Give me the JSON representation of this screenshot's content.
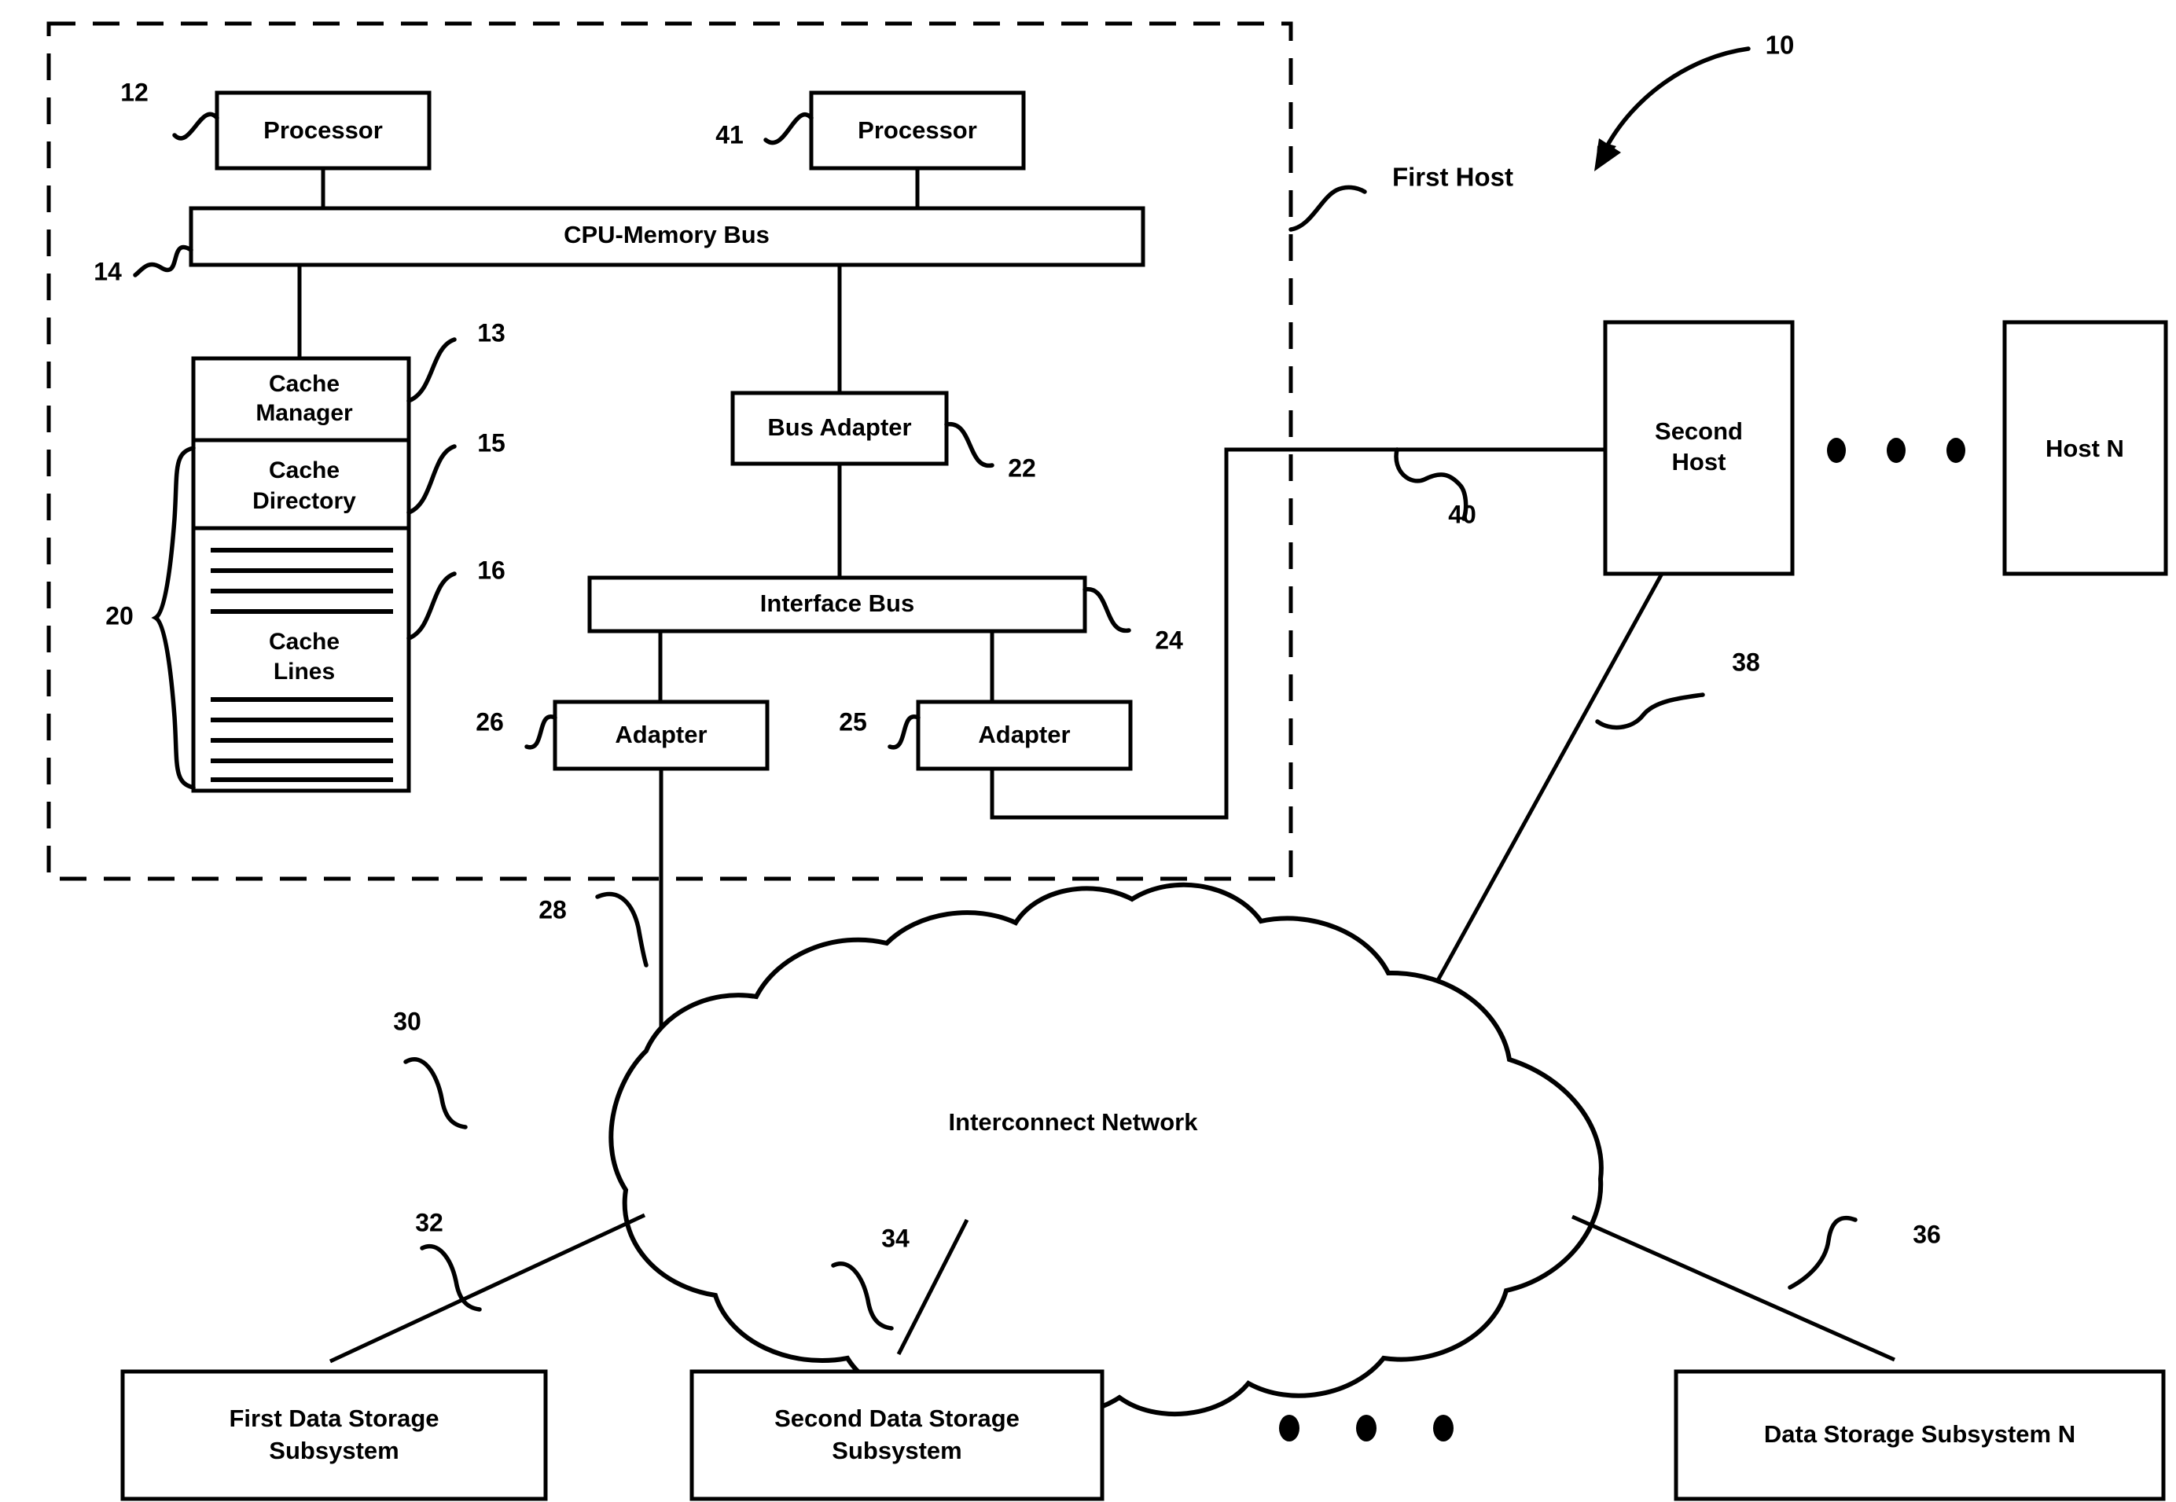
{
  "figure": {
    "title": "First Host",
    "top_ref": "10",
    "dashed_enclosure_label": "First Host"
  },
  "blocks": {
    "processor_1": {
      "label": "Processor",
      "ref": "12"
    },
    "processor_2": {
      "label": "Processor",
      "ref": "41"
    },
    "cpu_memory_bus": {
      "label": "CPU-Memory Bus",
      "ref": "14"
    },
    "cache_manager": {
      "label": "Cache Manager",
      "line1": "Cache",
      "line2": "Manager",
      "ref": "13"
    },
    "cache_directory": {
      "label": "Cache Directory",
      "line1": "Cache",
      "line2": "Directory",
      "ref": "15"
    },
    "cache_lines": {
      "label": "Cache Lines",
      "line1": "Cache",
      "line2": "Lines",
      "ref": "16"
    },
    "cache_group": {
      "ref": "20"
    },
    "bus_adapter": {
      "label": "Bus Adapter",
      "ref": "22"
    },
    "interface_bus": {
      "label": "Interface Bus",
      "ref": "24"
    },
    "adapter_26": {
      "label": "Adapter",
      "ref": "26"
    },
    "adapter_25": {
      "label": "Adapter",
      "ref": "25"
    },
    "second_host": {
      "label": "Second Host",
      "line1": "Second",
      "line2": "Host"
    },
    "host_n": {
      "label": "Host N"
    },
    "interconnect_network": {
      "label": "Interconnect Network",
      "ref": "30"
    },
    "storage_1": {
      "label": "First Data Storage Subsystem",
      "line1": "First Data Storage",
      "line2": "Subsystem"
    },
    "storage_2": {
      "label": "Second Data Storage Subsystem",
      "line1": "Second Data Storage",
      "line2": "Subsystem"
    },
    "storage_n": {
      "label": "Data Storage Subsystem N"
    }
  },
  "connection_refs": {
    "adapter_26_to_network": "28",
    "network_to_storage_1": "32",
    "network_to_storage_2": "34",
    "network_to_storage_n": "36",
    "second_host_to_network": "38",
    "adapter_25_to_second_host": "40"
  },
  "colors": {
    "ink": "#000000",
    "paper": "#ffffff"
  }
}
